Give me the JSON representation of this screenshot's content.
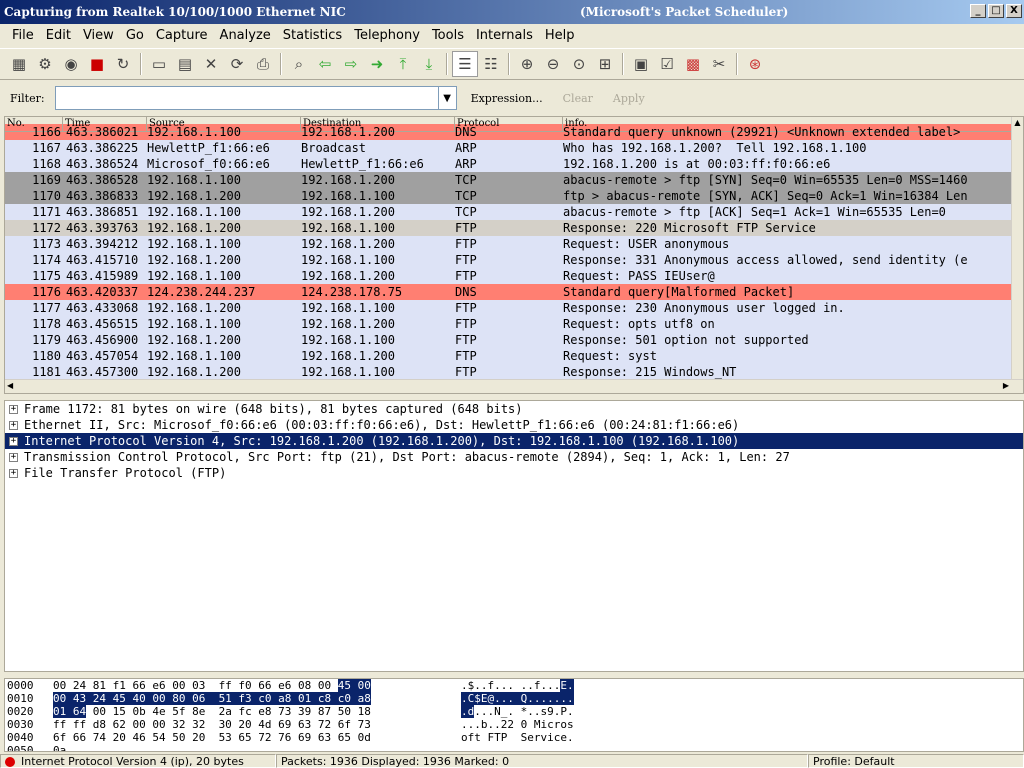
{
  "window": {
    "title": "Capturing from Realtek 10/100/1000 Ethernet NIC",
    "title_suffix": "(Microsoft's Packet Scheduler)",
    "min": "_",
    "max": "□",
    "close": "X"
  },
  "menu": [
    "File",
    "Edit",
    "View",
    "Go",
    "Capture",
    "Analyze",
    "Statistics",
    "Telephony",
    "Tools",
    "Internals",
    "Help"
  ],
  "toolbar": {
    "icons": [
      "list-interfaces-icon",
      "capture-options-icon",
      "start-capture-icon",
      "stop-capture-icon",
      "restart-capture-icon",
      "open-file-icon",
      "save-file-icon",
      "close-file-icon",
      "reload-icon",
      "print-icon",
      "find-icon",
      "go-back-icon",
      "go-forward-icon",
      "go-to-packet-icon",
      "go-first-icon",
      "go-last-icon",
      "colorize-icon",
      "auto-scroll-icon",
      "zoom-in-icon",
      "zoom-out-icon",
      "zoom-normal-icon",
      "resize-columns-icon",
      "capture-filters-icon",
      "display-filters-icon",
      "coloring-rules-icon",
      "preferences-icon",
      "help-icon"
    ]
  },
  "filter": {
    "label": "Filter:",
    "value": "",
    "expression": "Expression...",
    "clear": "Clear",
    "apply": "Apply"
  },
  "packet_list": {
    "columns": [
      "No.",
      "Time",
      "Source",
      "Destination",
      "Protocol",
      "info."
    ],
    "rows": [
      {
        "no": "1166",
        "time": "463.386021",
        "src": "192.168.1.100",
        "dst": "192.168.1.200",
        "proto": "DNS",
        "info": "Standard query unknown (29921) <Unknown extended label>",
        "bg": "#ff7f72"
      },
      {
        "no": "1167",
        "time": "463.386225",
        "src": "HewlettP_f1:66:e6",
        "dst": "Broadcast",
        "proto": "ARP",
        "info": "Who has 192.168.1.200?  Tell 192.168.1.100",
        "bg": "#dde3f6"
      },
      {
        "no": "1168",
        "time": "463.386524",
        "src": "Microsof_f0:66:e6",
        "dst": "HewlettP_f1:66:e6",
        "proto": "ARP",
        "info": "192.168.1.200 is at 00:03:ff:f0:66:e6",
        "bg": "#dde3f6"
      },
      {
        "no": "1169",
        "time": "463.386528",
        "src": "192.168.1.100",
        "dst": "192.168.1.200",
        "proto": "TCP",
        "info": "abacus-remote > ftp [SYN] Seq=0 Win=65535 Len=0 MSS=1460",
        "bg": "#a0a0a0"
      },
      {
        "no": "1170",
        "time": "463.386833",
        "src": "192.168.1.200",
        "dst": "192.168.1.100",
        "proto": "TCP",
        "info": "ftp > abacus-remote [SYN, ACK] Seq=0 Ack=1 Win=16384 Len",
        "bg": "#a0a0a0"
      },
      {
        "no": "1171",
        "time": "463.386851",
        "src": "192.168.1.100",
        "dst": "192.168.1.200",
        "proto": "TCP",
        "info": "abacus-remote > ftp [ACK] Seq=1 Ack=1 Win=65535 Len=0",
        "bg": "#dde3f6"
      },
      {
        "no": "1172",
        "time": "463.393763",
        "src": "192.168.1.200",
        "dst": "192.168.1.100",
        "proto": "FTP",
        "info": "Response: 220 Microsoft FTP Service",
        "bg": "#d4d0c8"
      },
      {
        "no": "1173",
        "time": "463.394212",
        "src": "192.168.1.100",
        "dst": "192.168.1.200",
        "proto": "FTP",
        "info": "Request: USER anonymous",
        "bg": "#dde3f6"
      },
      {
        "no": "1174",
        "time": "463.415710",
        "src": "192.168.1.200",
        "dst": "192.168.1.100",
        "proto": "FTP",
        "info": "Response: 331 Anonymous access allowed, send identity (e",
        "bg": "#dde3f6"
      },
      {
        "no": "1175",
        "time": "463.415989",
        "src": "192.168.1.100",
        "dst": "192.168.1.200",
        "proto": "FTP",
        "info": "Request: PASS IEUser@",
        "bg": "#dde3f6"
      },
      {
        "no": "1176",
        "time": "463.420337",
        "src": "124.238.244.237",
        "dst": "124.238.178.75",
        "proto": "DNS",
        "info": "Standard query[Malformed Packet]",
        "bg": "#ff7f72"
      },
      {
        "no": "1177",
        "time": "463.433068",
        "src": "192.168.1.200",
        "dst": "192.168.1.100",
        "proto": "FTP",
        "info": "Response: 230 Anonymous user logged in.",
        "bg": "#dde3f6"
      },
      {
        "no": "1178",
        "time": "463.456515",
        "src": "192.168.1.100",
        "dst": "192.168.1.200",
        "proto": "FTP",
        "info": "Request: opts utf8 on",
        "bg": "#dde3f6"
      },
      {
        "no": "1179",
        "time": "463.456900",
        "src": "192.168.1.200",
        "dst": "192.168.1.100",
        "proto": "FTP",
        "info": "Response: 501 option not supported",
        "bg": "#dde3f6"
      },
      {
        "no": "1180",
        "time": "463.457054",
        "src": "192.168.1.100",
        "dst": "192.168.1.200",
        "proto": "FTP",
        "info": "Request: syst",
        "bg": "#dde3f6"
      },
      {
        "no": "1181",
        "time": "463.457300",
        "src": "192.168.1.200",
        "dst": "192.168.1.100",
        "proto": "FTP",
        "info": "Response: 215 Windows_NT",
        "bg": "#dde3f6"
      }
    ]
  },
  "details": [
    {
      "text": "Frame 1172: 81 bytes on wire (648 bits), 81 bytes captured (648 bits)",
      "selected": false
    },
    {
      "text": "Ethernet II, Src: Microsof_f0:66:e6 (00:03:ff:f0:66:e6), Dst: HewlettP_f1:66:e6 (00:24:81:f1:66:e6)",
      "selected": false
    },
    {
      "text": "Internet Protocol Version 4, Src: 192.168.1.200 (192.168.1.200), Dst: 192.168.1.100 (192.168.1.100)",
      "selected": true
    },
    {
      "text": "Transmission Control Protocol, Src Port: ftp (21), Dst Port: abacus-remote (2894), Seq: 1, Ack: 1, Len: 27",
      "selected": false
    },
    {
      "text": "File Transfer Protocol (FTP)",
      "selected": false
    }
  ],
  "hex": [
    {
      "off": "0000",
      "b1": "00 24 81 f1 66 e6 00 03  ff f0 66 e6 08 00 ",
      "b2": "45 00",
      "a1": ".$..f... ..f...",
      "a2": "E."
    },
    {
      "off": "0010",
      "b1": "",
      "b2": "00 43 24 45 40 00 80 06  51 f3 c0 a8 01 c8 c0 a8",
      "a1": "",
      "a2": ".C$E@... Q......."
    },
    {
      "off": "0020",
      "b1": " 00 15 0b 4e 5f 8e  2a fc e8 73 39 87 50 18",
      "b2": "01 64",
      "a1": "...N_. *..s9.P.",
      "a2": ".d"
    },
    {
      "off": "0030",
      "b1": "ff ff d8 62 00 00 32 32  30 20 4d 69 63 72 6f 73",
      "b2": "",
      "a1": "...b..22 0 Micros",
      "a2": ""
    },
    {
      "off": "0040",
      "b1": "6f 66 74 20 46 54 50 20  53 65 72 76 69 63 65 0d",
      "b2": "",
      "a1": "oft FTP  Service.",
      "a2": ""
    },
    {
      "off": "0050",
      "b1": "0a",
      "b2": "",
      "a1": ".",
      "a2": ""
    }
  ],
  "status": {
    "left": "Internet Protocol Version 4 (ip), 20 bytes",
    "middle": "Packets: 1936 Displayed: 1936 Marked: 0",
    "right": "Profile: Default"
  }
}
